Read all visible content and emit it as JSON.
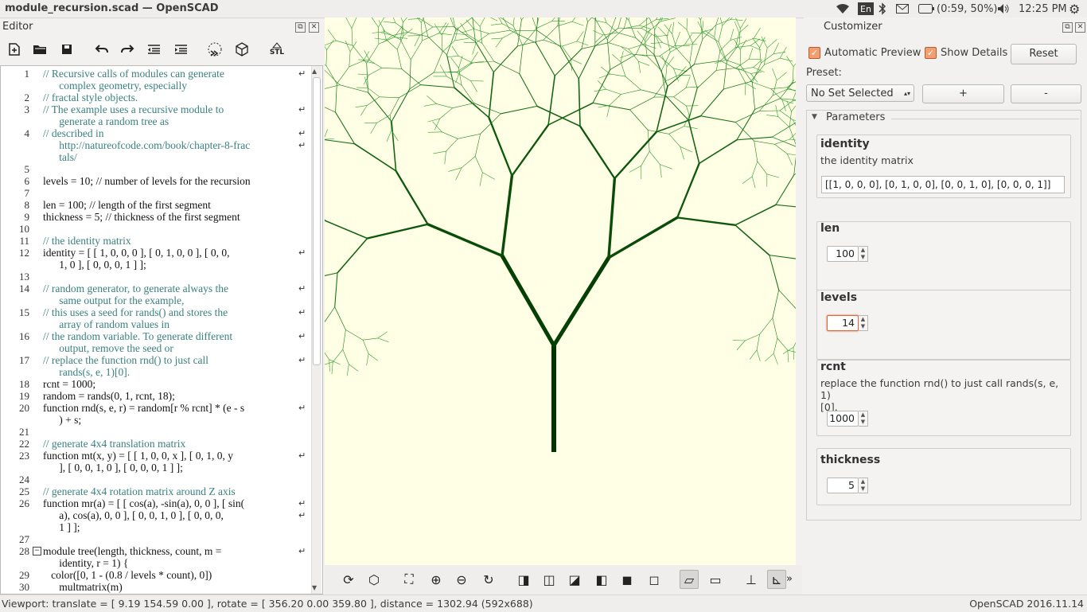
{
  "window": {
    "title": "module_recursion.scad — OpenSCAD"
  },
  "tray": {
    "keyboard": "En",
    "battery": "(0:59, 50%)",
    "clock": "12:25 PM"
  },
  "editor": {
    "title": "Editor",
    "toolbar": [
      "new-file-icon",
      "open-file-icon",
      "save-icon",
      "undo-icon",
      "redo-icon",
      "unindent-icon",
      "indent-icon",
      "preview-icon",
      "render-icon",
      "export-stl-icon"
    ],
    "stl_label": "STL",
    "lines": [
      {
        "n": "1",
        "t": "// Recursive calls of modules can generate",
        "c": "cm",
        "w": true
      },
      {
        "n": "",
        "t": "      complex geometry, especially",
        "c": "cm"
      },
      {
        "n": "2",
        "t": "// fractal style objects.",
        "c": "cm"
      },
      {
        "n": "3",
        "t": "// The example uses a recursive module to",
        "c": "cm",
        "w": true
      },
      {
        "n": "",
        "t": "      generate a random tree as",
        "c": "cm"
      },
      {
        "n": "4",
        "t": "// described in",
        "c": "cm",
        "w": true
      },
      {
        "n": "",
        "t": "      http://natureofcode.com/book/chapter-8-frac",
        "c": "cm",
        "w": true
      },
      {
        "n": "",
        "t": "      tals/",
        "c": "cm"
      },
      {
        "n": "5",
        "t": "",
        "c": ""
      },
      {
        "n": "6",
        "t": "levels = 10; // number of levels for the recursion",
        "c": "code"
      },
      {
        "n": "7",
        "t": "",
        "c": ""
      },
      {
        "n": "8",
        "t": "len = 100; // length of the first segment",
        "c": "code"
      },
      {
        "n": "9",
        "t": "thickness = 5; // thickness of the first segment",
        "c": "code"
      },
      {
        "n": "10",
        "t": "",
        "c": ""
      },
      {
        "n": "11",
        "t": "// the identity matrix",
        "c": "cm"
      },
      {
        "n": "12",
        "t": "identity = [ [ 1, 0, 0, 0 ], [ 0, 1, 0, 0 ], [ 0, 0,",
        "c": "code",
        "w": true
      },
      {
        "n": "",
        "t": "      1, 0 ], [ 0, 0, 0, 1 ] ];",
        "c": "code"
      },
      {
        "n": "13",
        "t": "",
        "c": ""
      },
      {
        "n": "14",
        "t": "// random generator, to generate always the",
        "c": "cm",
        "w": true
      },
      {
        "n": "",
        "t": "      same output for the example,",
        "c": "cm"
      },
      {
        "n": "15",
        "t": "// this uses a seed for rands() and stores the",
        "c": "cm",
        "w": true
      },
      {
        "n": "",
        "t": "      array of random values in",
        "c": "cm"
      },
      {
        "n": "16",
        "t": "// the random variable. To generate different",
        "c": "cm",
        "w": true
      },
      {
        "n": "",
        "t": "      output, remove the seed or",
        "c": "cm"
      },
      {
        "n": "17",
        "t": "// replace the function rnd() to just call",
        "c": "cm",
        "w": true
      },
      {
        "n": "",
        "t": "      rands(s, e, 1)[0].",
        "c": "cm"
      },
      {
        "n": "18",
        "t": "rcnt = 1000;",
        "c": "code"
      },
      {
        "n": "19",
        "t": "random = rands(0, 1, rcnt, 18);",
        "c": "code"
      },
      {
        "n": "20",
        "t": "function rnd(s, e, r) = random[r % rcnt] * (e - s",
        "c": "code",
        "w": true
      },
      {
        "n": "",
        "t": "      ) + s;",
        "c": "code"
      },
      {
        "n": "21",
        "t": "",
        "c": ""
      },
      {
        "n": "22",
        "t": "// generate 4x4 translation matrix",
        "c": "cm"
      },
      {
        "n": "23",
        "t": "function mt(x, y) = [ [ 1, 0, 0, x ], [ 0, 1, 0, y",
        "c": "code",
        "w": true
      },
      {
        "n": "",
        "t": "      ], [ 0, 0, 1, 0 ], [ 0, 0, 0, 1 ] ];",
        "c": "code"
      },
      {
        "n": "24",
        "t": "",
        "c": ""
      },
      {
        "n": "25",
        "t": "// generate 4x4 rotation matrix around Z axis",
        "c": "cm"
      },
      {
        "n": "26",
        "t": "function mr(a) = [ [ cos(a), -sin(a), 0, 0 ], [ sin(",
        "c": "code",
        "w": true
      },
      {
        "n": "",
        "t": "      a), cos(a), 0, 0 ], [ 0, 0, 1, 0 ], [ 0, 0, 0,",
        "c": "code",
        "w": true
      },
      {
        "n": "",
        "t": "      1 ] ];",
        "c": "code"
      },
      {
        "n": "27",
        "t": "",
        "c": ""
      },
      {
        "n": "28",
        "t": "module tree(length, thickness, count, m =",
        "c": "code",
        "w": true,
        "fold": true
      },
      {
        "n": "",
        "t": "      identity, r = 1) {",
        "c": "code"
      },
      {
        "n": "29",
        "t": "   color([0, 1 - (0.8 / levels * count), 0])",
        "c": "code"
      },
      {
        "n": "30",
        "t": "      multmatrix(m)",
        "c": "code"
      }
    ]
  },
  "viewtoolbar": [
    "preview-icon",
    "render-icon",
    "view-all-icon",
    "zoom-in-icon",
    "zoom-out-icon",
    "reset-view-icon",
    "view-right-icon",
    "view-top-icon",
    "view-bottom-icon",
    "view-left-icon",
    "view-front-icon",
    "view-back-icon",
    "perspective-icon",
    "orthogonal-icon",
    "show-axes-icon",
    "show-scale-markers-icon"
  ],
  "status": {
    "viewport": "Viewport: translate = [ 9.19 154.59 0.00 ], rotate = [ 356.20 0.00 359.80 ], distance = 1302.94 (592x688)",
    "version": "OpenSCAD 2016.11.14"
  },
  "customizer": {
    "title": "Customizer",
    "automatic_preview": "Automatic Preview",
    "show_details": "Show Details",
    "reset": "Reset",
    "preset_label": "Preset:",
    "preset_value": "No Set Selected",
    "add": "+",
    "remove": "-",
    "parameters": "Parameters",
    "params": {
      "identity": {
        "name": "identity",
        "desc": "the identity matrix",
        "value": "[[1, 0, 0, 0], [0, 1, 0, 0], [0, 0, 1, 0], [0, 0, 0, 1]]"
      },
      "len": {
        "name": "len",
        "value": "100"
      },
      "levels": {
        "name": "levels",
        "value": "14"
      },
      "rcnt": {
        "name": "rcnt",
        "desc": "replace the function rnd() to just call rands(s, e, 1)",
        "desc2": "[0].",
        "value": "1000"
      },
      "thickness": {
        "name": "thickness",
        "value": "5"
      }
    }
  },
  "colors": {
    "accent": "#e0653a",
    "trunk": "#003300",
    "leaves": "#2a9a2a",
    "viewport_bg": "#ffffe5"
  }
}
